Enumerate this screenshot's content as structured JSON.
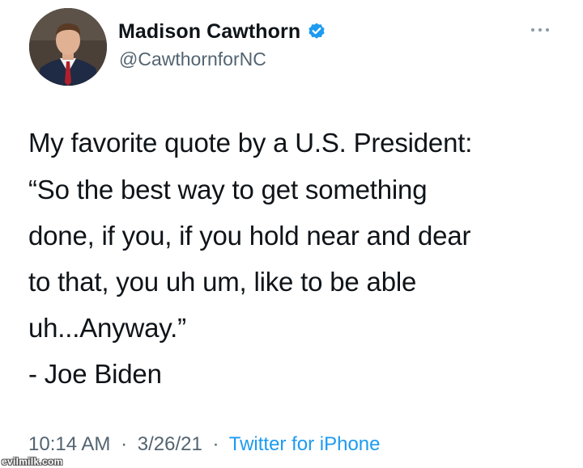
{
  "author": {
    "display_name": "Madison Cawthorn",
    "handle": "@CawthornforNC",
    "verified": true
  },
  "tweet": {
    "intro": "My favorite quote by a U.S. President:",
    "quote_lines": [
      "“So the best way to get something",
      "done, if you, if you hold near and dear",
      "to that, you uh um, like to be able",
      "uh...Anyway.”"
    ],
    "attribution": "- Joe Biden"
  },
  "meta": {
    "time": "10:14 AM",
    "date": "3/26/21",
    "separator": "·",
    "source": "Twitter for iPhone"
  },
  "watermark": "evilmilk.com",
  "colors": {
    "text": "#0f1419",
    "secondary": "#536471",
    "link": "#1d9bf0",
    "verified": "#1d9bf0"
  },
  "icons": {
    "verified": "verified-badge-icon",
    "more": "more-options-icon"
  }
}
